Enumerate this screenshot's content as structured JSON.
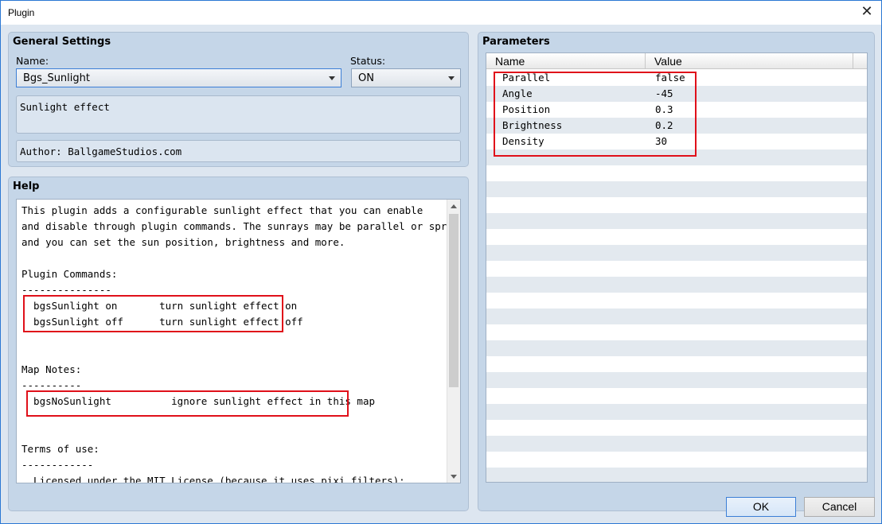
{
  "window": {
    "title": "Plugin",
    "close_glyph": "✕"
  },
  "general": {
    "title": "General Settings",
    "name_label": "Name:",
    "name_value": "Bgs_Sunlight",
    "status_label": "Status:",
    "status_value": "ON",
    "description": "Sunlight effect",
    "author": "Author: BallgameStudios.com"
  },
  "help": {
    "title": "Help",
    "lines": [
      "This plugin adds a configurable sunlight effect that you can enable",
      "and disable through plugin commands. The sunrays may be parallel or spreading",
      "and you can set the sun position, brightness and more.",
      "",
      "Plugin Commands:",
      "---------------",
      "  bgsSunlight on       turn sunlight effect on",
      "  bgsSunlight off      turn sunlight effect off",
      "",
      "",
      "Map Notes:",
      "----------",
      "  bgsNoSunlight          ignore sunlight effect in this map",
      "",
      "",
      "Terms of use:",
      "------------",
      "  Licensed under the MIT License (because it uses pixi filters):"
    ]
  },
  "parameters": {
    "title": "Parameters",
    "columns": [
      "Name",
      "Value"
    ],
    "rows": [
      {
        "name": "Parallel",
        "value": "false"
      },
      {
        "name": "Angle",
        "value": "-45"
      },
      {
        "name": "Position",
        "value": "0.3"
      },
      {
        "name": "Brightness",
        "value": "0.2"
      },
      {
        "name": "Density",
        "value": "30"
      }
    ]
  },
  "buttons": {
    "ok": "OK",
    "cancel": "Cancel"
  },
  "colors": {
    "highlight": "#e0101a",
    "accent": "#3c7fd6"
  }
}
